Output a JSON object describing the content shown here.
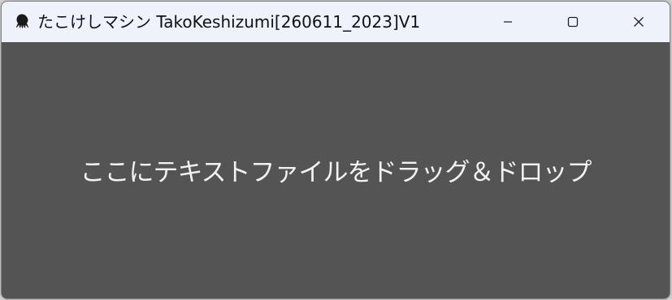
{
  "window": {
    "title": "たこけしマシン TakoKeshizumi[260611_2023]V1",
    "app_icon": "octopus-icon",
    "controls": {
      "minimize_icon": "minimize-icon",
      "maximize_icon": "maximize-icon",
      "close_icon": "close-icon"
    }
  },
  "drop_zone": {
    "text": "ここにテキストファイルをドラッグ＆ドロップ",
    "background_color": "#545454",
    "text_color": "#f2f2f2"
  },
  "colors": {
    "titlebar": "#eef2fb"
  }
}
